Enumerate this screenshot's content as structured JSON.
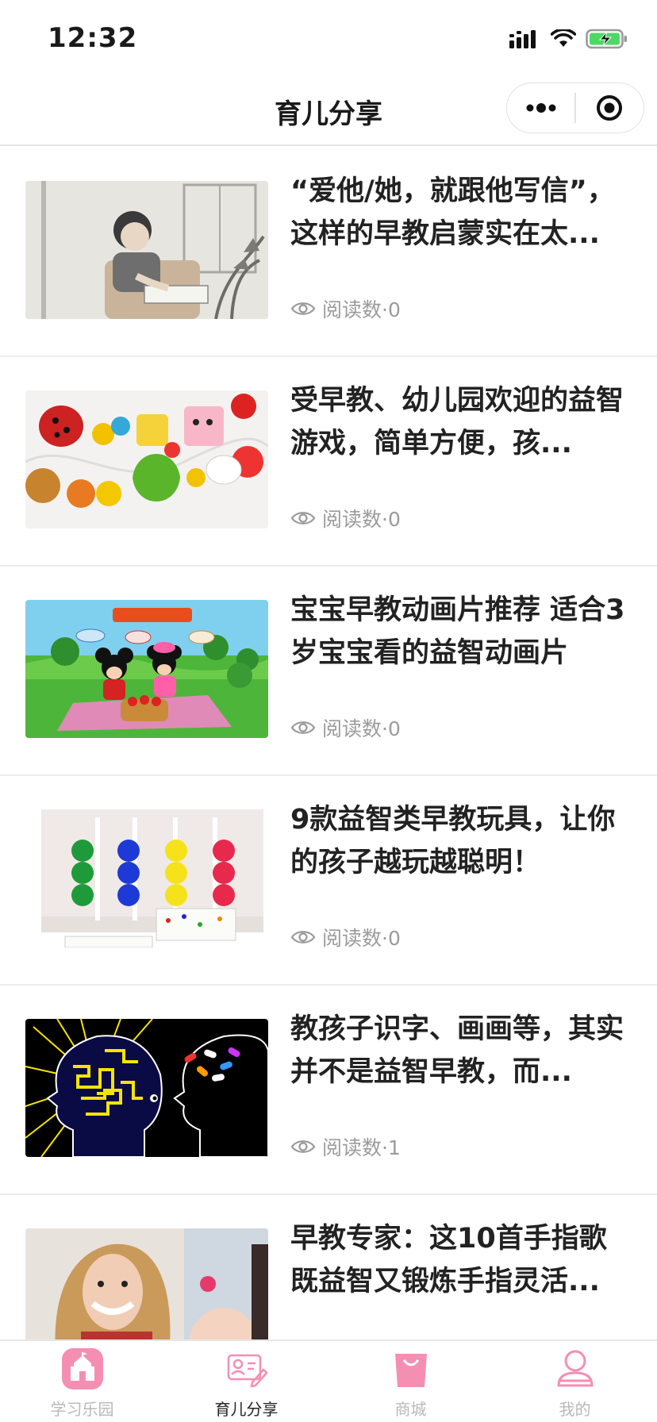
{
  "status_bar": {
    "time": "12:32"
  },
  "nav": {
    "title": "育儿分享"
  },
  "accent": "#f48fb1",
  "articles": [
    {
      "title": "“爱他/她，就跟他写信”，这样的早教启蒙实在太...",
      "meta": "阅读数·0",
      "thumb": "boy-writing-illustration"
    },
    {
      "title": "受早教、幼儿园欢迎的益智游戏，简单方便，孩...",
      "meta": "阅读数·0",
      "thumb": "wooden-lacing-beads"
    },
    {
      "title": "宝宝早教动画片推荐 适合3岁宝宝看的益智动画片",
      "meta": "阅读数·0",
      "thumb": "mickey-minnie-picnic"
    },
    {
      "title": "9款益智类早教玩具，让你的孩子越玩越聪明！",
      "meta": "阅读数·0",
      "thumb": "color-bead-sorting-toy"
    },
    {
      "title": "教孩子识字、画画等，其实并不是益智早教，而...",
      "meta": "阅读数·1",
      "thumb": "brain-maze-silhouettes"
    },
    {
      "title": "早教专家：这10首手指歌既益智又锻炼手指灵活...",
      "meta": "",
      "thumb": "woman-with-baby-photo"
    }
  ],
  "tabs": [
    {
      "label": "学习乐园",
      "icon": "school-icon"
    },
    {
      "label": "育儿分享",
      "icon": "profile-card-icon"
    },
    {
      "label": "商城",
      "icon": "shopping-bag-icon"
    },
    {
      "label": "我的",
      "icon": "user-icon"
    }
  ]
}
